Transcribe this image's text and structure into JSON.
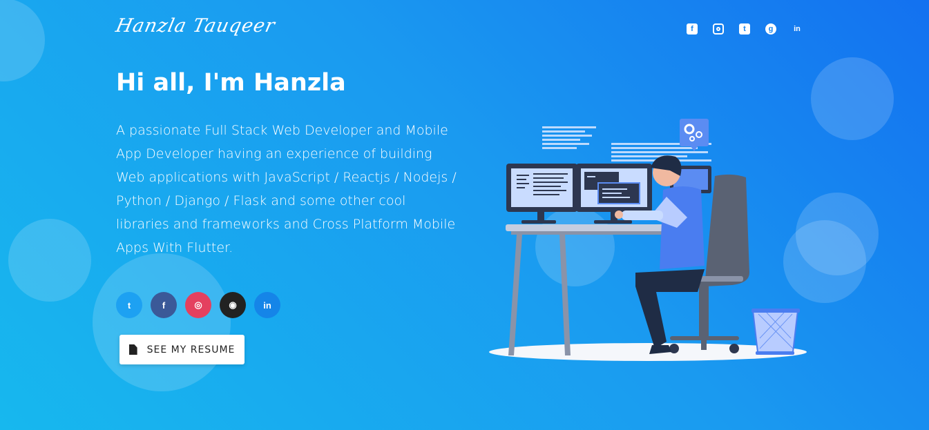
{
  "header": {
    "logo_text": "Hanzla Tauqeer",
    "social": [
      {
        "icon": "facebook-icon",
        "glyph": "f"
      },
      {
        "icon": "instagram-icon",
        "glyph": ""
      },
      {
        "icon": "twitter-icon",
        "glyph": "t"
      },
      {
        "icon": "github-icon",
        "glyph": "g"
      },
      {
        "icon": "linkedin-icon",
        "glyph": "in"
      }
    ]
  },
  "hero": {
    "title": "Hi all, I'm Hanzla",
    "description": "A passionate Full Stack Web Developer and Mobile App Developer having an experience of building Web applications with JavaScript / Reactjs / Nodejs / Python / Django / Flask and some other cool libraries and frameworks and Cross Platform Mobile Apps With Flutter.",
    "social_buttons": [
      {
        "icon": "twitter-icon",
        "glyph": "t",
        "color": "#1da1f2"
      },
      {
        "icon": "facebook-icon",
        "glyph": "f",
        "color": "#3b5998"
      },
      {
        "icon": "instagram-icon",
        "glyph": "◎",
        "color": "#e4405f"
      },
      {
        "icon": "github-icon",
        "glyph": "◉",
        "color": "#222222"
      },
      {
        "icon": "linkedin-icon",
        "glyph": "in",
        "color": "#0e76a8"
      }
    ],
    "resume_button": "SEE MY RESUME"
  },
  "colors": {
    "gradient_start": "#1371f0",
    "gradient_end": "#17b8ee"
  }
}
